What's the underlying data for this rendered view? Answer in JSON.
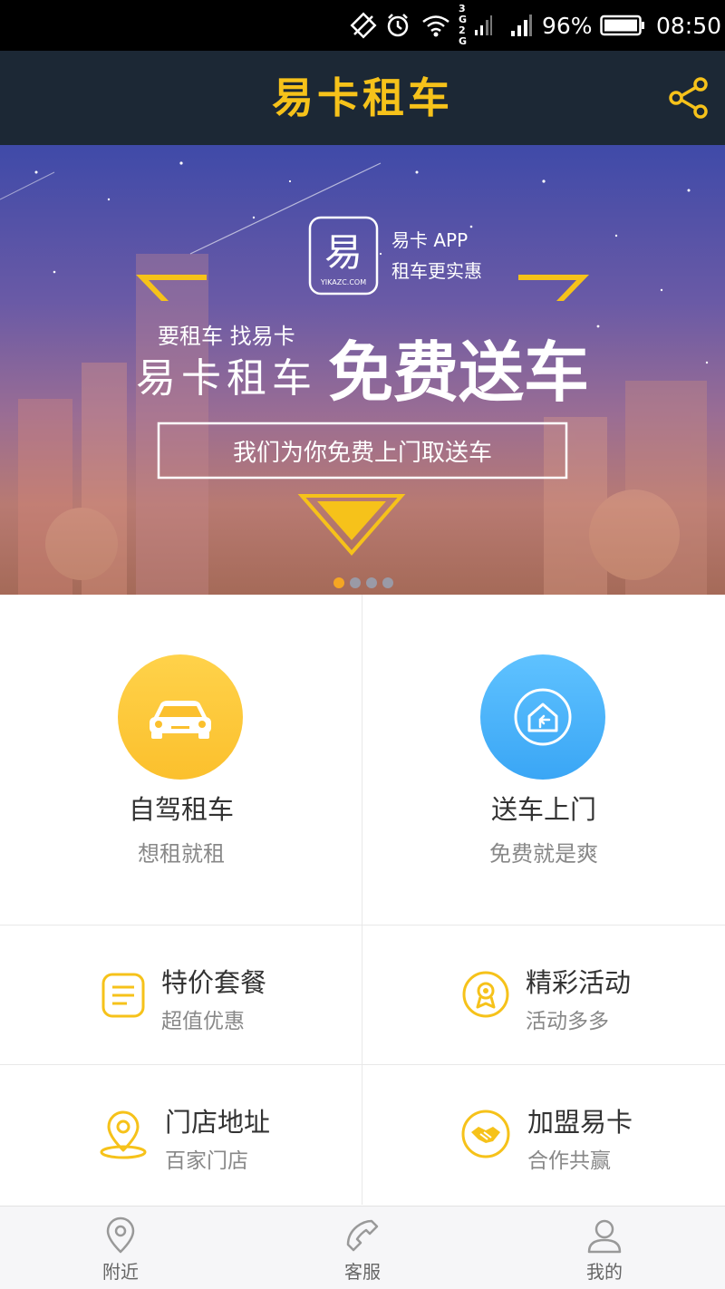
{
  "status_bar": {
    "network": "3G 2G",
    "battery": "96%",
    "time": "08:50"
  },
  "header": {
    "title": "易卡租车"
  },
  "banner": {
    "logo_char": "易",
    "logo_sub": "YIKAZC.COM",
    "app_line1": "易卡 APP",
    "app_line2": "租车更实惠",
    "slogan_small": "要租车 找易卡",
    "brand": "易卡租车",
    "headline": "免费送车",
    "box_text": "我们为你免费上门取送车",
    "slides_total": 4,
    "active_slide": 1
  },
  "tiles": {
    "self_drive": {
      "title": "自驾租车",
      "sub": "想租就租",
      "icon": "car-icon"
    },
    "delivery": {
      "title": "送车上门",
      "sub": "免费就是爽",
      "icon": "home-return-icon"
    },
    "special": {
      "title": "特价套餐",
      "sub": "超值优惠",
      "icon": "note-list-icon"
    },
    "events": {
      "title": "精彩活动",
      "sub": "活动多多",
      "icon": "badge-icon"
    },
    "stores": {
      "title": "门店地址",
      "sub": "百家门店",
      "icon": "location-pin-icon"
    },
    "franchise": {
      "title": "加盟易卡",
      "sub": "合作共赢",
      "icon": "handshake-icon"
    }
  },
  "bottom_nav": [
    {
      "label": "附近",
      "icon": "location-icon"
    },
    {
      "label": "客服",
      "icon": "phone-icon"
    },
    {
      "label": "我的",
      "icon": "user-icon"
    }
  ],
  "colors": {
    "header_bg": "#1c2835",
    "brand_yellow": "#f6c21a",
    "accent_blue": "#3aa6f5"
  }
}
